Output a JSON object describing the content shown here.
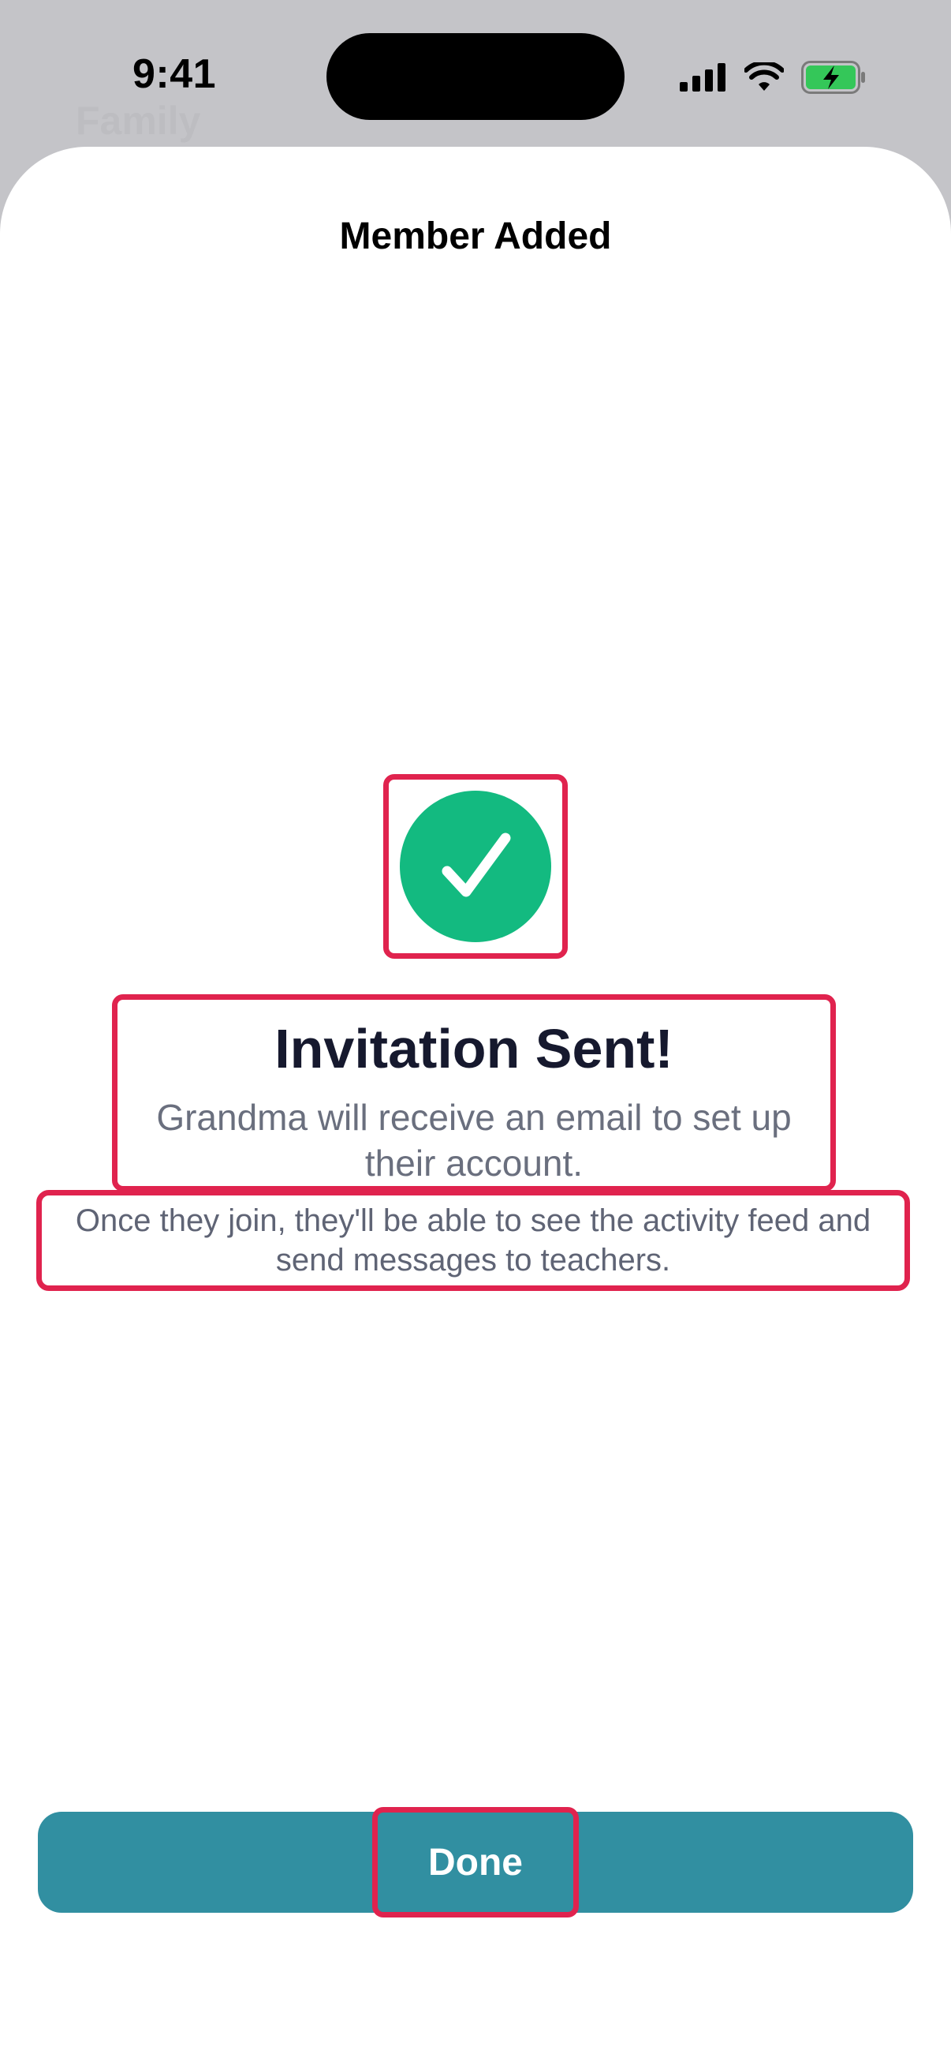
{
  "status_bar": {
    "time": "9:41",
    "icons": [
      "signal-icon",
      "wifi-icon",
      "battery-charging-icon"
    ],
    "battery_color": "#34c759"
  },
  "background_screen": {
    "title": "Family"
  },
  "sheet": {
    "title": "Member Added",
    "success_icon": "checkmark-circle-icon",
    "success_color": "#13ba80",
    "headline": "Invitation Sent!",
    "message": "Grandma will receive an email to set up their account.",
    "note": "Once they join, they'll be able to see the activity feed and send messages to teachers.",
    "done_label": "Done",
    "button_color": "#318fa1",
    "highlight_color": "#e0234e"
  }
}
